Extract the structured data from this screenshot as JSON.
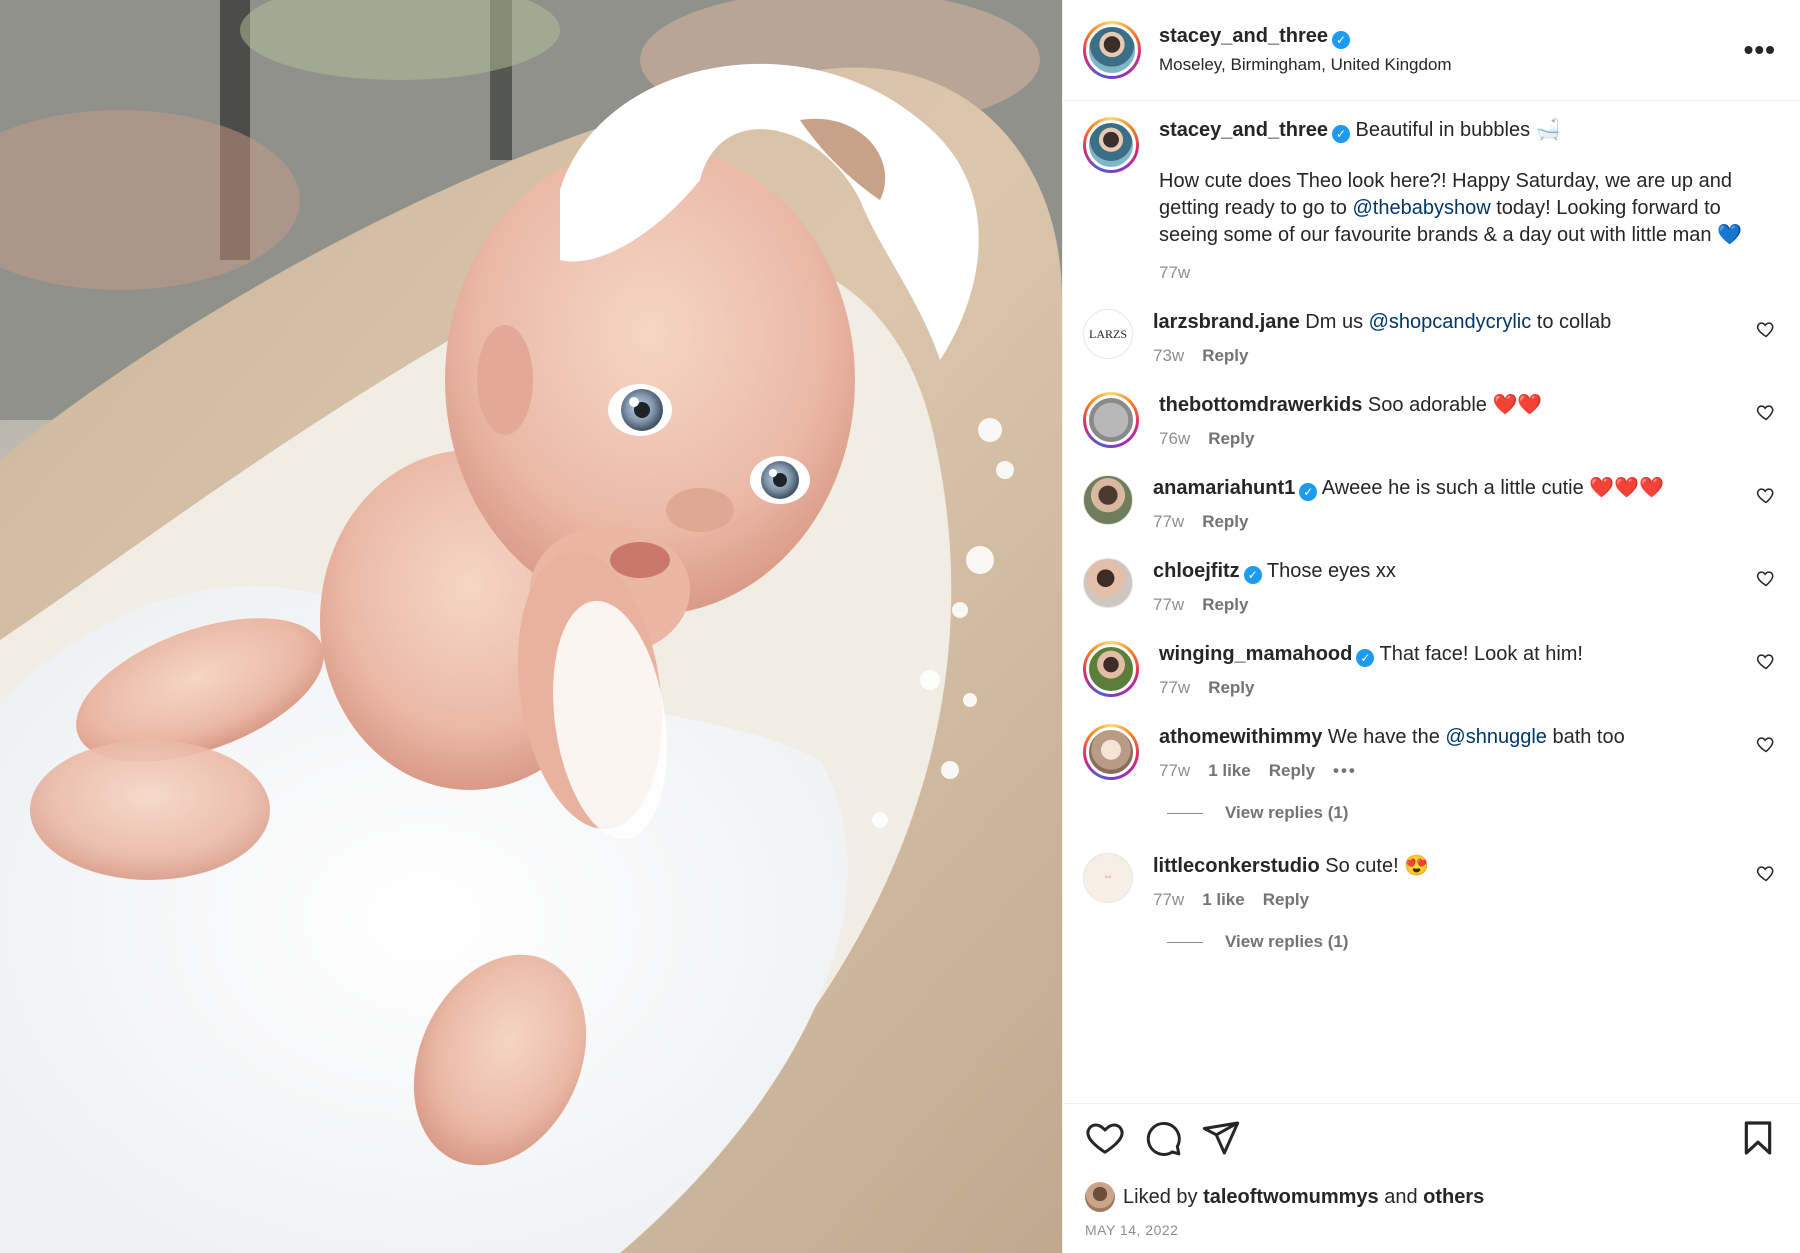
{
  "post_author": {
    "username": "stacey_and_three",
    "location": "Moseley, Birmingham, United Kingdom"
  },
  "caption": {
    "username": "stacey_and_three",
    "title": "Beautiful in bubbles 🛁",
    "body_part1": "How cute does Theo look here?! Happy Saturday, we are up and getting ready to go to ",
    "mention": "@thebabyshow",
    "body_part2": " today! Looking forward to seeing some of our favourite brands & a day out with little man 💙",
    "time": "77w"
  },
  "comments": [
    {
      "username": "larzsbrand.jane",
      "text_pre": "Dm us ",
      "mention": "@shopcandycrylic",
      "text_post": " to collab",
      "time": "73w",
      "likes": "",
      "reply": "Reply",
      "avatar_text": "LARZS"
    },
    {
      "username": "thebottomdrawerkids",
      "text_pre": "Soo adorable ❤️❤️",
      "mention": "",
      "text_post": "",
      "time": "76w",
      "likes": "",
      "reply": "Reply"
    },
    {
      "username": "anamariahunt1",
      "text_pre": "Aweee he is such a little cutie ❤️❤️❤️",
      "mention": "",
      "text_post": "",
      "time": "77w",
      "likes": "",
      "reply": "Reply"
    },
    {
      "username": "chloejfitz",
      "text_pre": "Those eyes xx",
      "mention": "",
      "text_post": "",
      "time": "77w",
      "likes": "",
      "reply": "Reply"
    },
    {
      "username": "winging_mamahood",
      "text_pre": "That face! Look at him!",
      "mention": "",
      "text_post": "",
      "time": "77w",
      "likes": "",
      "reply": "Reply"
    },
    {
      "username": "athomewithimmy",
      "text_pre": "We have the ",
      "mention": "@shnuggle",
      "text_post": " bath too",
      "time": "77w",
      "likes": "1 like",
      "reply": "Reply",
      "view_replies": "View replies (1)"
    },
    {
      "username": "littleconkerstudio",
      "text_pre": "So cute! 😍",
      "mention": "",
      "text_post": "",
      "time": "77w",
      "likes": "1 like",
      "reply": "Reply",
      "view_replies": "View replies (1)"
    }
  ],
  "footer": {
    "liked_by_prefix": "Liked by ",
    "liked_by_user": "taleoftwomummys",
    "liked_by_and": " and ",
    "liked_by_others": "others",
    "date": "MAY 14, 2022"
  },
  "icons": {
    "more": "more-options-icon",
    "like": "heart-icon",
    "comment": "comment-icon",
    "share": "send-icon",
    "save": "bookmark-icon",
    "verified": "verified-badge-icon"
  },
  "colors": {
    "verified": "#1d9bf0",
    "mention": "#00376b",
    "muted": "#8e8e8e"
  }
}
